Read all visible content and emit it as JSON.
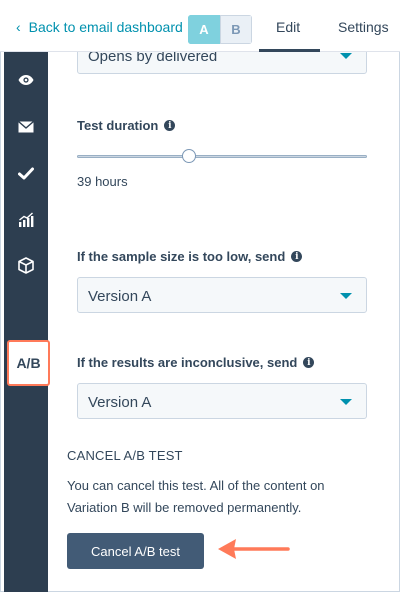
{
  "header": {
    "back_label": "Back to email dashboard",
    "variant_a": "A",
    "variant_b": "B",
    "tabs": [
      {
        "label": "Edit"
      },
      {
        "label": "Settings"
      }
    ]
  },
  "sidebar": {
    "items": [
      {
        "icon": "eye-icon"
      },
      {
        "icon": "envelope-icon"
      },
      {
        "icon": "checkmark-icon"
      },
      {
        "icon": "analytics-chart-icon"
      },
      {
        "icon": "cube-icon"
      },
      {
        "label": "A/B"
      }
    ]
  },
  "settings": {
    "winning_metric_value": "Opens by delivered",
    "test_duration_label": "Test duration",
    "test_duration_value": "39 hours",
    "sample_too_low_label": "If the sample size is too low, send",
    "sample_too_low_value": "Version A",
    "inconclusive_label": "If the results are inconclusive, send",
    "inconclusive_value": "Version A"
  },
  "cancel": {
    "heading": "CANCEL A/B TEST",
    "description": "You can cancel this test. All of the content on Variation B will be removed permanently.",
    "button_label": "Cancel A/B test"
  },
  "colors": {
    "accent": "#0091ae",
    "sidebar": "#2d3e50",
    "highlight": "#ff7a59",
    "button": "#425b76"
  }
}
